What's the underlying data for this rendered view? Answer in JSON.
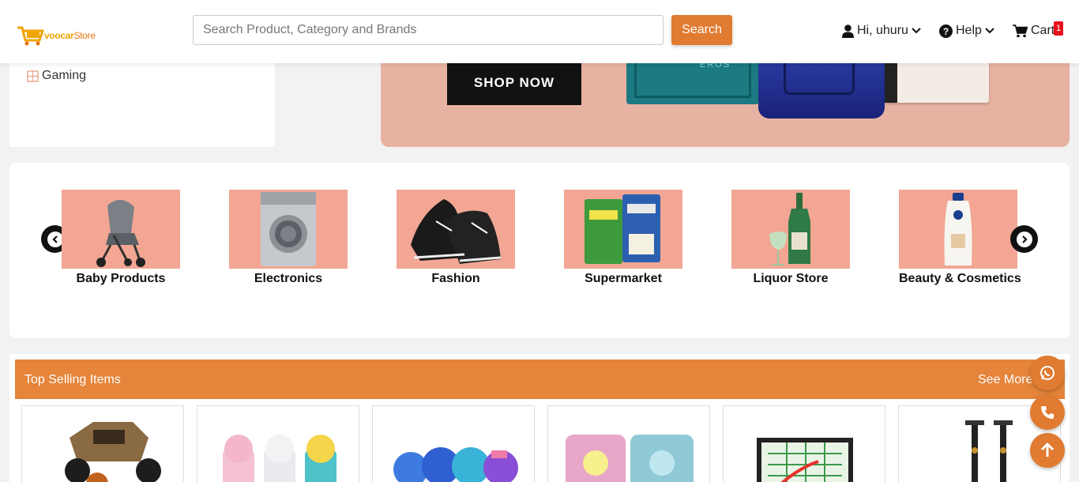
{
  "header": {
    "logo_text_a": "voocar",
    "logo_text_b": "Store",
    "search_placeholder": "Search Product, Category and Brands",
    "search_button": "Search",
    "user_label": "Hi, uhuru",
    "help_label": "Help",
    "cart_label": "Cart",
    "cart_count": "1"
  },
  "sidebar": {
    "items": [
      {
        "label": "Gaming",
        "icon": "gamepad-icon"
      }
    ]
  },
  "banner": {
    "cta": "SHOP NOW",
    "product_text": "EROS"
  },
  "categories": {
    "items": [
      {
        "label": "Baby Products",
        "icon": "stroller-image"
      },
      {
        "label": "Electronics",
        "icon": "washing-machine-image"
      },
      {
        "label": "Fashion",
        "icon": "sneakers-image"
      },
      {
        "label": "Supermarket",
        "icon": "grocery-bags-image"
      },
      {
        "label": "Liquor Store",
        "icon": "gin-bottle-image"
      },
      {
        "label": "Beauty & Cosmetics",
        "icon": "lotion-bottle-image"
      }
    ]
  },
  "top_selling": {
    "title": "Top Selling Items",
    "see_more": "See More",
    "products": [
      {
        "icon": "rc-car-image"
      },
      {
        "icon": "kids-bottles-image"
      },
      {
        "icon": "character-bottles-image"
      },
      {
        "icon": "toy-set-image"
      },
      {
        "icon": "snakes-ladders-image"
      },
      {
        "icon": "scooter-image"
      }
    ]
  },
  "colors": {
    "accent": "#e07b31",
    "section_bar": "#e5843a",
    "category_bg": "#f2a693",
    "badge": "#e8111d"
  }
}
